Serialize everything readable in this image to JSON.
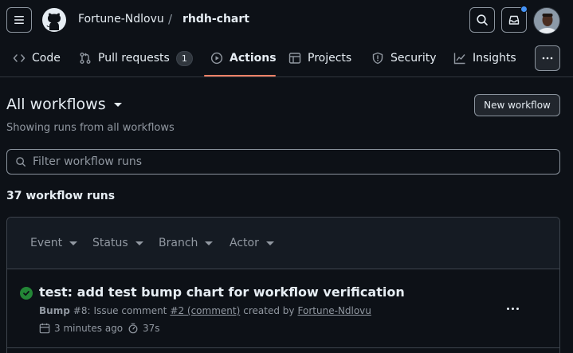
{
  "header": {
    "owner": "Fortune-Ndlovu",
    "separator": "/",
    "repo": "rhdh-chart"
  },
  "tabs": [
    {
      "label": "Code",
      "icon": "code-icon"
    },
    {
      "label": "Pull requests",
      "icon": "git-pull-request-icon",
      "count": "1"
    },
    {
      "label": "Actions",
      "icon": "play-icon",
      "active": true
    },
    {
      "label": "Projects",
      "icon": "table-icon"
    },
    {
      "label": "Security",
      "icon": "shield-icon"
    },
    {
      "label": "Insights",
      "icon": "graph-icon"
    }
  ],
  "page": {
    "title": "All workflows",
    "subtitle": "Showing runs from all workflows",
    "new_workflow_label": "New workflow",
    "filter_placeholder": "Filter workflow runs",
    "run_count": "37 workflow runs"
  },
  "filters": [
    "Event",
    "Status",
    "Branch",
    "Actor"
  ],
  "runs": [
    {
      "title": "test: add test bump chart for workflow verification",
      "workflow": "Bump",
      "run_number": "#8:",
      "event": "Issue comment",
      "link": "#2 (comment)",
      "created_by": "created by",
      "author": "Fortune-Ndlovu",
      "time_ago": "3 minutes ago",
      "duration": "37s",
      "status": "success"
    }
  ],
  "colors": {
    "accent_underline": "#f78166",
    "success": "#238636",
    "notification": "#4493f8",
    "background": "#0d1117"
  }
}
